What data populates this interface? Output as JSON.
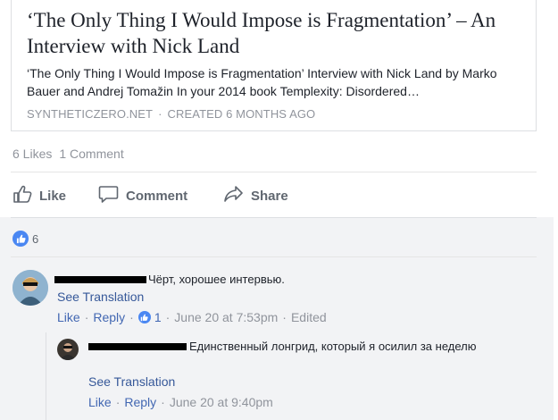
{
  "link_preview": {
    "title": "‘The Only Thing I Would Impose is Fragmentation’ – An Interview with Nick Land",
    "description": "‘The Only Thing I Would Impose is Fragmentation’ Interview with Nick Land by Marko Bauer and Andrej Tomažin In your 2014 book Templexity: Disordered…",
    "domain": "SYNTHETICZERO.NET",
    "separator": "·",
    "created": "CREATED 6 MONTHS AGO"
  },
  "counts": {
    "likes": "6 Likes",
    "comments": "1 Comment"
  },
  "actions": {
    "like": "Like",
    "comment": "Comment",
    "share": "Share"
  },
  "reactions": {
    "count": "6"
  },
  "comments": [
    {
      "text": "Чёрт, хорошее интервью.",
      "see_translation": "See Translation",
      "like": "Like",
      "reply": "Reply",
      "like_count": "1",
      "time": "June 20 at 7:53pm",
      "edited": "Edited"
    }
  ],
  "reply": {
    "text": "Единственный лонгрид, который я осилил за неделю",
    "see_translation": "See Translation",
    "like": "Like",
    "reply": "Reply",
    "time": "June 20 at 9:40pm"
  },
  "colors": {
    "link": "#4267b2",
    "muted": "#90949c",
    "like_blue": "#4a87f2",
    "comment_bg": "#f2f3f5"
  }
}
